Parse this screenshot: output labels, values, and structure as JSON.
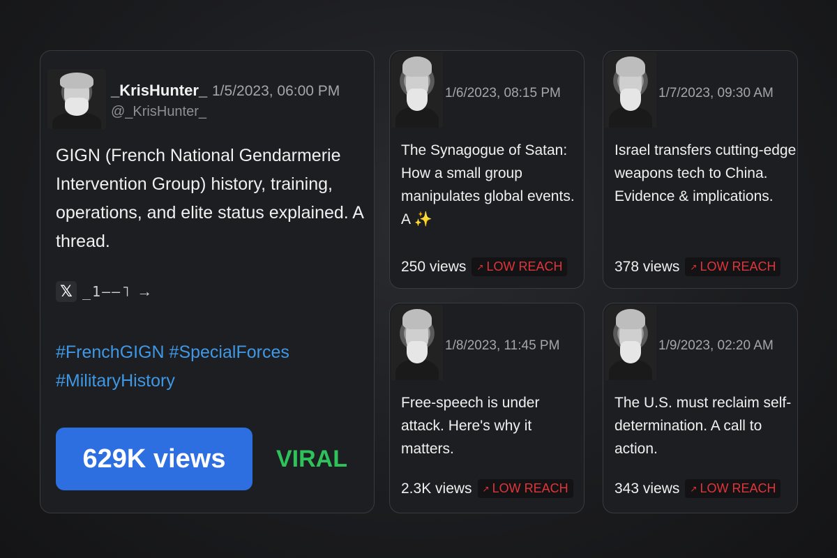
{
  "main_post": {
    "display_name": "_KrisHunter_",
    "timestamp": "1/5/2023, 06:00 PM",
    "handle": "@_KrisHunter_",
    "text": "GIGN (French National Gendarmerie Intervention Group) history, training, operations, and elite status  explained. A thread.",
    "icon_glyphs": "_1––˥",
    "hashtags": "#FrenchGIGN #SpecialForces #MilitaryHistory",
    "views": "629K views",
    "status": "VIRAL",
    "colors": {
      "views_pill": "#2d6fe0",
      "status": "#2fc25a",
      "hashtags": "#3f98e6"
    }
  },
  "posts": [
    {
      "timestamp": "1/6/2023, 08:15 PM",
      "text": "The Synagogue of Satan: How a small group manipulates global events. A ✨",
      "views": "250 views",
      "badge": "LOW REACH"
    },
    {
      "timestamp": "1/7/2023, 09:30 AM",
      "text": "Israel transfers cutting-edge weapons tech to China. Evidence & implications.",
      "views": "378 views",
      "badge": "LOW REACH"
    },
    {
      "timestamp": "1/8/2023, 11:45 PM",
      "text": "Free-speech is under attack. Here's why it matters.",
      "views": "2.3K views",
      "badge": "LOW REACH"
    },
    {
      "timestamp": "1/9/2023, 02:20 AM",
      "text": "The U.S. must reclaim self-determination. A call to action.",
      "views": "343 views",
      "badge": "LOW REACH"
    }
  ],
  "badge_color": "#e0353a"
}
